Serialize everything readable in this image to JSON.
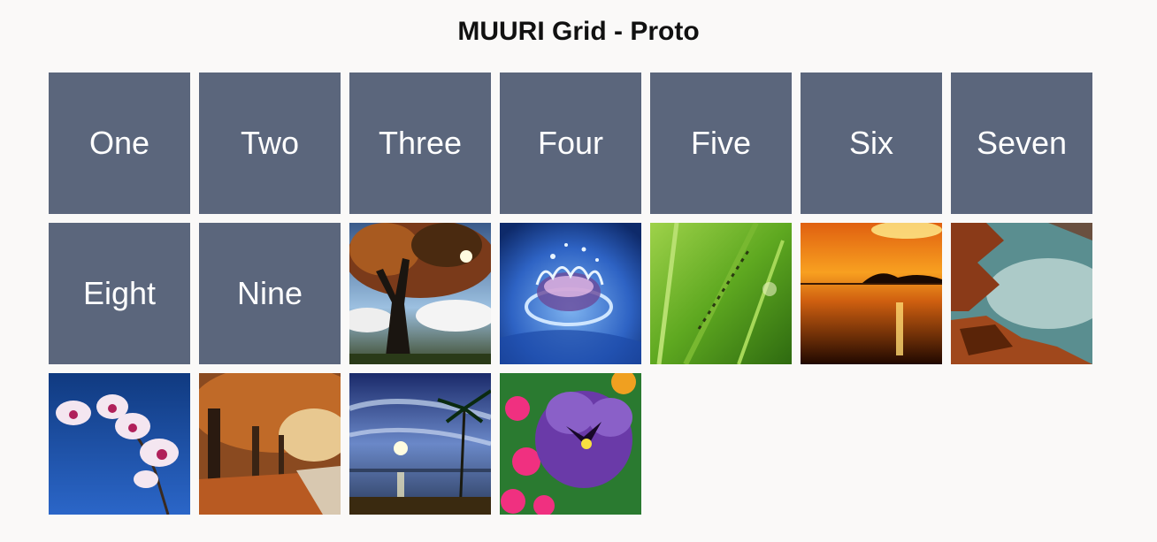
{
  "page": {
    "title": "MUURI Grid - Proto"
  },
  "grid": {
    "text_tiles": [
      {
        "label": "One"
      },
      {
        "label": "Two"
      },
      {
        "label": "Three"
      },
      {
        "label": "Four"
      },
      {
        "label": "Five"
      },
      {
        "label": "Six"
      },
      {
        "label": "Seven"
      },
      {
        "label": "Eight"
      },
      {
        "label": "Nine"
      }
    ],
    "image_tiles": [
      {
        "image": "autumn-tree-photo"
      },
      {
        "image": "water-drop-photo"
      },
      {
        "image": "ants-on-grass-photo"
      },
      {
        "image": "sunset-lake-photo"
      },
      {
        "image": "rocky-coast-photo"
      },
      {
        "image": "orchid-photo"
      },
      {
        "image": "autumn-park-photo"
      },
      {
        "image": "beach-palm-sunset-photo"
      },
      {
        "image": "pansy-flower-photo"
      }
    ]
  }
}
